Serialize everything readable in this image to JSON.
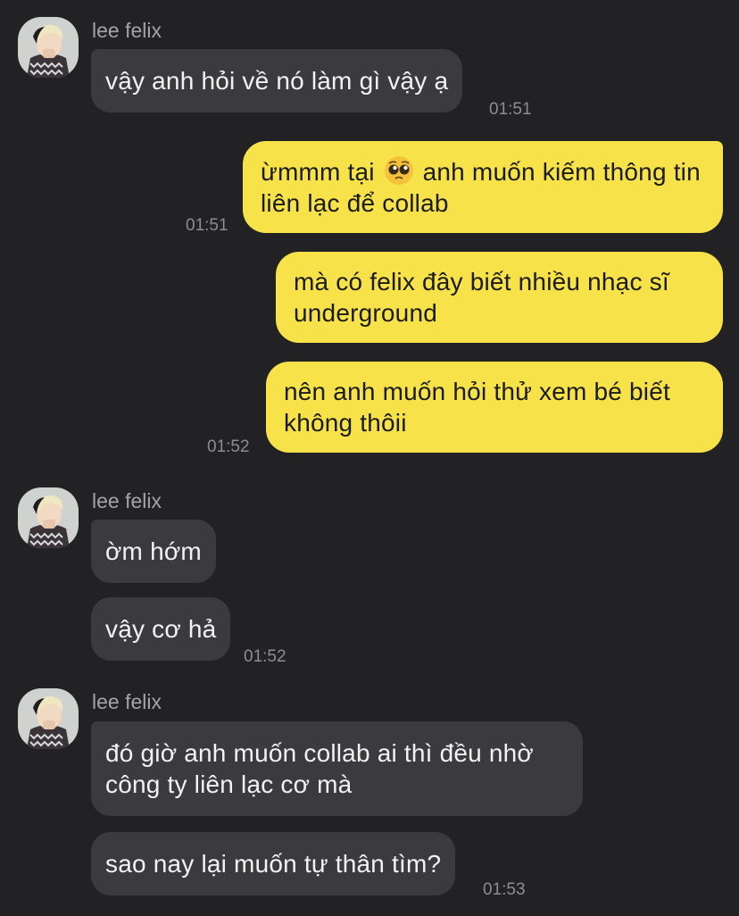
{
  "accent_colors": {
    "background": "#222224",
    "incoming_bubble": "#3b3b3e",
    "outgoing_bubble": "#f7e349"
  },
  "messages": [
    {
      "sender": "lee felix",
      "text": "vậy anh hỏi về nó làm gì vậy ạ",
      "time": "01:51"
    },
    {
      "text_before": "ừmmm tại",
      "emoji": "pleading-face-icon",
      "text_after": "anh muốn kiếm thông tin liên lạc để collab",
      "time": "01:51"
    },
    {
      "text": "mà có felix đây biết nhiều nhạc sĩ underground"
    },
    {
      "text": "nên anh muốn hỏi thử xem bé biết không thôii",
      "time": "01:52"
    },
    {
      "sender": "lee felix",
      "text": "ờm hớm"
    },
    {
      "text": "vậy cơ hả",
      "time": "01:52"
    },
    {
      "sender": "lee felix",
      "text": "đó giờ anh muốn collab ai thì đều nhờ công ty liên lạc cơ mà"
    },
    {
      "text": "sao nay lại muốn tự thân tìm?",
      "time": "01:53"
    }
  ]
}
